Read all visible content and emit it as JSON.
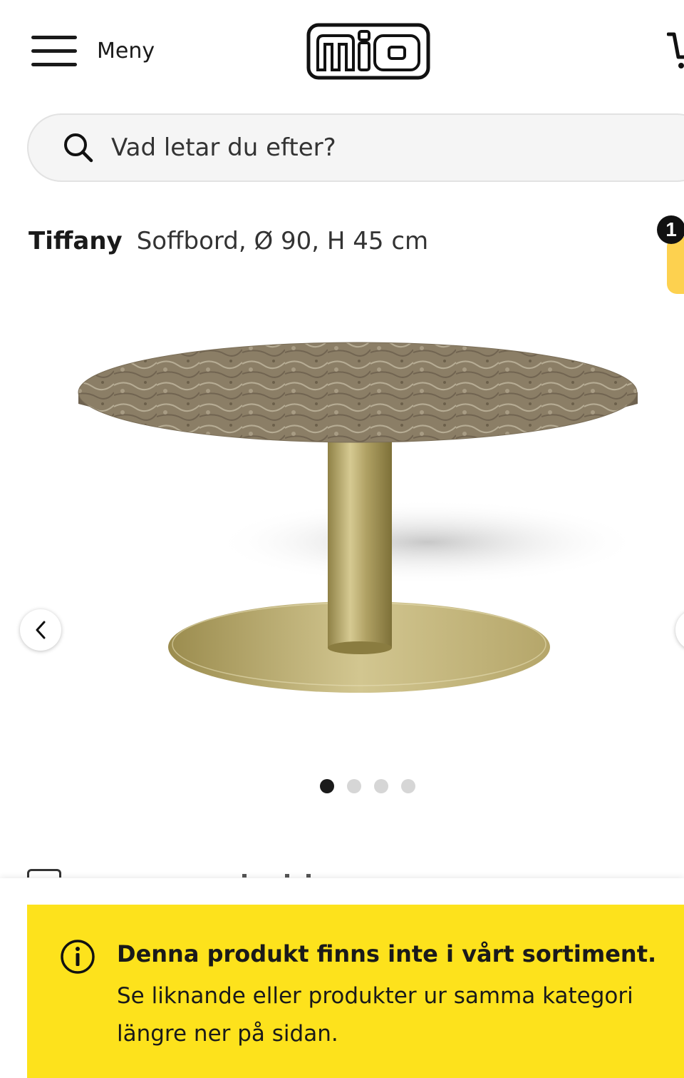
{
  "header": {
    "menu_label": "Meny",
    "logo_text": "mio",
    "menu_icon": "hamburger-icon",
    "cart_icon": "cart-icon"
  },
  "search": {
    "placeholder": "Vad letar du efter?",
    "icon": "search-icon"
  },
  "product": {
    "brand": "Tiffany",
    "description": "Soffbord, Ø 90, H 45 cm",
    "image_alt": "Round coffee table with brown marble top and brass pedestal base"
  },
  "compare": {
    "count": "1"
  },
  "gallery": {
    "image_count": 4,
    "active_index": 0,
    "prev_icon": "chevron-left-icon",
    "next_icon": "chevron-right-icon"
  },
  "notice": {
    "title": "Denna produkt finns inte i vårt sortiment.",
    "text": "Se liknande eller produkter ur samma kategori längre ner på sidan.",
    "icon": "info-icon"
  },
  "colors": {
    "notice_bg": "#fde21c",
    "badge_tab": "#fdd14f",
    "text": "#1a1a1a",
    "search_bg": "#f5f5f5"
  }
}
